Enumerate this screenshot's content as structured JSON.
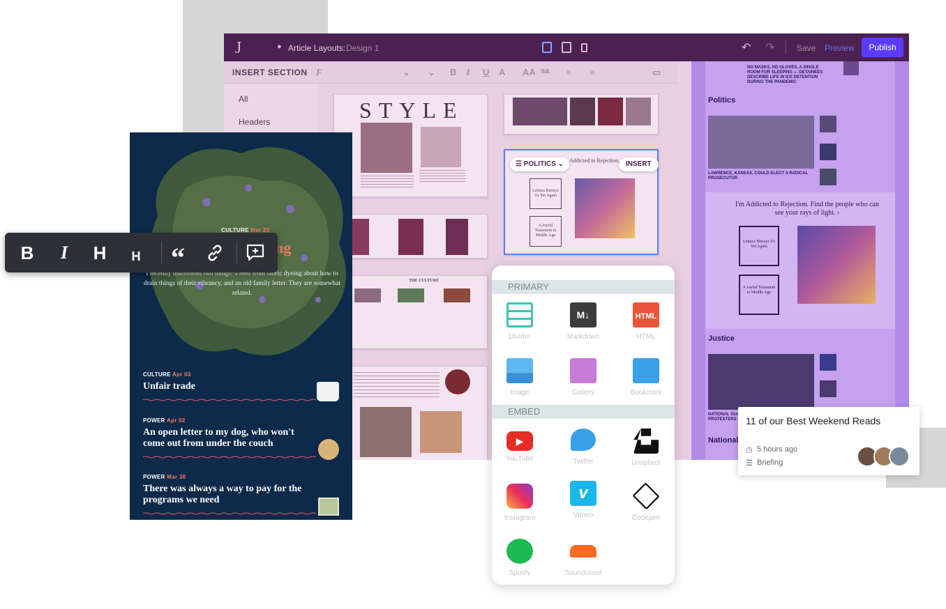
{
  "editor": {
    "logo": "J",
    "layout_label": "Article Layouts:",
    "layout_design": "Design 1",
    "save": "Save",
    "preview": "Preview",
    "publish": "Publish",
    "insert_section": "INSERT SECTION",
    "sidebar": [
      "All",
      "Headers"
    ],
    "style_title": "STYLE",
    "politics_chip": "POLITICS",
    "insert_chip": "INSERT",
    "rejection_headline": "I'm Addicted to Rejection. Find the people who can see your rays of light. ›",
    "lettuce_box": "Lettuce Betrays Us Yet Again",
    "joyful_box": "A Joyful Testament to Middle Age",
    "the_culture": "THE CULTURE"
  },
  "preview": {
    "top_headline": "NO MASKS, NO GLOVES, A SINGLE ROOM FOR SLEEPING — DETAINEES DESCRIBE LIFE IN ICE DETENTION DURING THE PANDEMIC",
    "politics_head": "Politics",
    "politics_lead": "LAWRENCE, KANSAS, COULD ELECT A RADICAL PROSECUTOR",
    "rejection_headline": "I'm Addicted to Rejection. Find the people who can see your rays of light. ›",
    "lettuce_box": "Lettuce Betrays Us Yet Again",
    "joyful_box": "A Joyful Testament to Middle Age",
    "justice_head": "Justice",
    "justice_lead": "NATIONAL GUARD PROTESTERS \"E",
    "national_head": "National"
  },
  "mobile": {
    "feature_category": "CULTURE",
    "feature_date": "Mar 20",
    "feature_title_fragment": "ng",
    "lede": "I recently discovered two things: a reed from fabric dyeing about how to drain things of their vibrancy, and an old family letter. They are somewhat related.",
    "stories": [
      {
        "category": "CULTURE",
        "date": "Apr 03",
        "title": "Unfair trade"
      },
      {
        "category": "POWER",
        "date": "Apr 02",
        "title": "An open letter to my dog, who won't come out from under the couch"
      },
      {
        "category": "POWER",
        "date": "Mar 30",
        "title": "There was always a way to pay for the programs we need"
      }
    ]
  },
  "format_toolbar": {
    "bold": "B",
    "italic": "I",
    "heading_large": "H",
    "heading_small": "H"
  },
  "insert_panel": {
    "primary_label": "PRIMARY",
    "embed_label": "EMBED",
    "primary": [
      "Divider",
      "Markdown",
      "HTML",
      "Image",
      "Gallery",
      "Bookmark"
    ],
    "embed": [
      "YouTube",
      "Twitter",
      "Unsplash",
      "Instagram",
      "Vimeo",
      "Codepen",
      "Spotify",
      "Soundcloud"
    ]
  },
  "notification": {
    "title": "11 of our Best Weekend Reads",
    "time": "5 hours ago",
    "tag": "Briefing"
  },
  "colors": {
    "editor_bar": "#4b2152",
    "publish": "#5b3cff",
    "mobile_bg": "#0e2a4a",
    "accent_coral": "#f27a5e",
    "preview_purple": "#b38ae8"
  }
}
